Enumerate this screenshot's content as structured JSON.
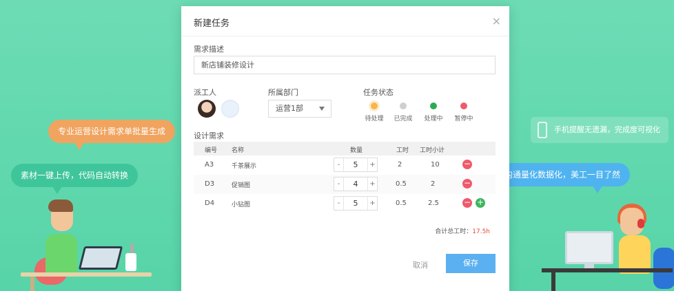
{
  "bubbles": {
    "orange": "专业运营设计需求单批量生成",
    "green": "素材一键上传，代码自动转换",
    "blue": "沟通量化数据化，美工一目了然",
    "light": "手机提醒无遗漏，完成度可视化"
  },
  "dialog": {
    "title": "新建任务",
    "close": "×",
    "desc_label": "需求描述",
    "desc_value": "新店铺装修设计",
    "worker_label": "派工人",
    "dept_label": "所属部门",
    "dept_value": "运营1部",
    "status_label": "任务状态",
    "statuses": [
      "待处理",
      "已完成",
      "处理中",
      "暂停中"
    ],
    "design_label": "设计需求",
    "headers": [
      "编号",
      "名称",
      "数量",
      "工时",
      "工时小计"
    ],
    "rows": [
      {
        "code": "A3",
        "name": "千茶展示",
        "qty": "5",
        "hours": "2",
        "subtotal": "10"
      },
      {
        "code": "D3",
        "name": "促销图",
        "qty": "4",
        "hours": "0.5",
        "subtotal": "2"
      },
      {
        "code": "D4",
        "name": "小钻图",
        "qty": "5",
        "hours": "0.5",
        "subtotal": "2.5"
      }
    ],
    "total_label": "合计总工时：",
    "total_value": "17.5h",
    "cancel": "取消",
    "save": "保存"
  },
  "colors": {
    "background": "#5ed8ad",
    "primary": "#5ab0f0",
    "pending": "#f6b64a",
    "processing": "#2eaa56",
    "paused": "#ee5a6c"
  }
}
